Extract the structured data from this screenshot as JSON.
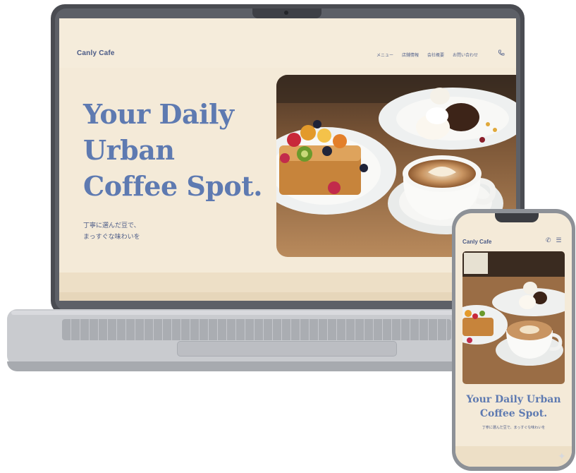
{
  "desktop": {
    "brand": "Canly Cafe",
    "nav": [
      "メニュー",
      "店舗情報",
      "会社概要",
      "お問い合わせ"
    ],
    "hero_title_lines": [
      "Your Daily",
      "Urban",
      "Coffee Spot."
    ],
    "hero_subtitle_lines": [
      "丁寧に選んだ豆で、",
      "まっすぐな味わいを"
    ]
  },
  "mobile": {
    "brand": "Canly Cafe",
    "hero_title_lines": [
      "Your Daily Urban",
      "Coffee Spot."
    ],
    "hero_subtitle": "丁寧に選んだ豆で、まっすぐな味わいを"
  },
  "icons": {
    "phone": "phone-icon",
    "menu": "hamburger-icon",
    "sparkle": "sparkle-icon"
  },
  "colors": {
    "page_bg": "#f4ead8",
    "brand_blue": "#5e7ab1",
    "text_navy": "#4a5a86",
    "device_dark": "#4a4c52",
    "device_silver": "#c9cbcf"
  }
}
